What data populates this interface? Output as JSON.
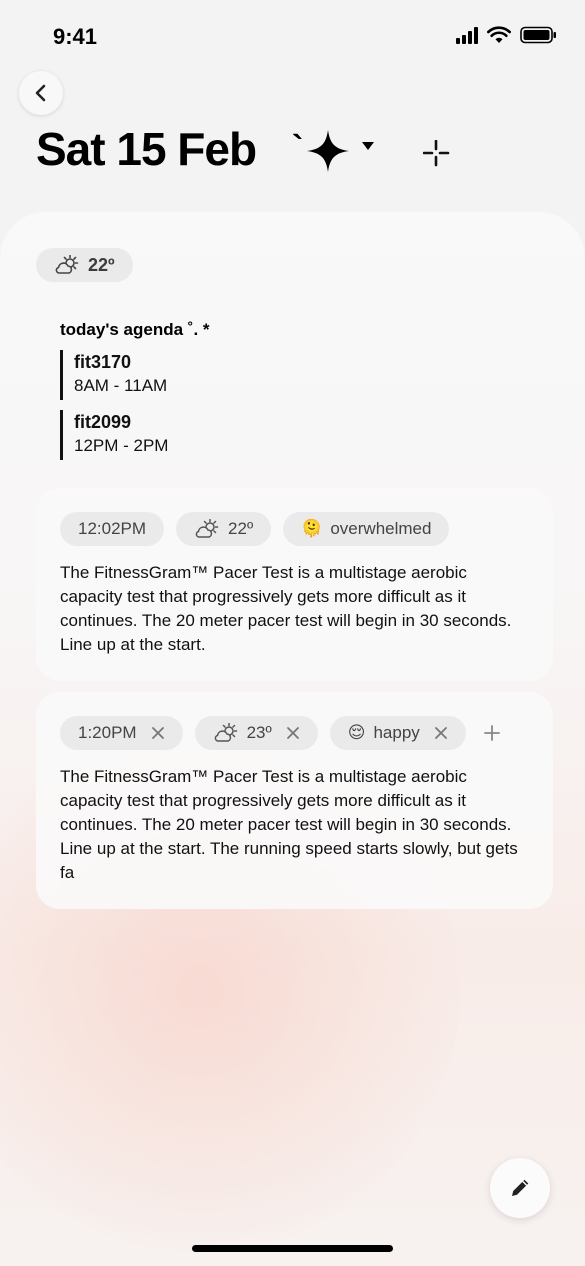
{
  "status_bar": {
    "time": "9:41"
  },
  "header": {
    "title": "Sat 15 Feb",
    "tick": "`"
  },
  "weather_summary": {
    "temp": "22º"
  },
  "agenda": {
    "heading": "today's agenda ˚. *",
    "items": [
      {
        "name": "fit3170",
        "time": "8AM - 11AM"
      },
      {
        "name": "fit2099",
        "time": "12PM - 2PM"
      }
    ]
  },
  "entries": [
    {
      "time": "12:02PM",
      "temp": "22º",
      "mood_emoji": "🫠",
      "mood": "overwhelmed",
      "text": "The FitnessGram™ Pacer Test is a multistage aerobic capacity test that progressively gets more difficult as it continues. The 20 meter pacer test will begin in 30 seconds. Line up at the start."
    },
    {
      "time": "1:20PM",
      "temp": "23º",
      "mood_emoji": "😌",
      "mood": "happy",
      "text": "The FitnessGram™ Pacer Test is a multistage aerobic capacity test that progressively gets more difficult as it continues. The 20 meter pacer test will begin in 30 seconds. Line up at the start. The running speed starts slowly, but gets fa"
    }
  ],
  "icons": {
    "back": "chevron-left-icon",
    "sparkle": "sparkle-icon",
    "dropdown": "caret-down-icon",
    "add_sparkle": "sparkle-add-icon",
    "weather": "partly-cloudy-icon",
    "remove": "close-icon",
    "add": "plus-icon",
    "edit": "pencil-icon"
  },
  "colors": {
    "background": "#f3f3f3",
    "chip": "#eaeaea",
    "text": "#111111",
    "accent_blush": "#f8cec4"
  }
}
